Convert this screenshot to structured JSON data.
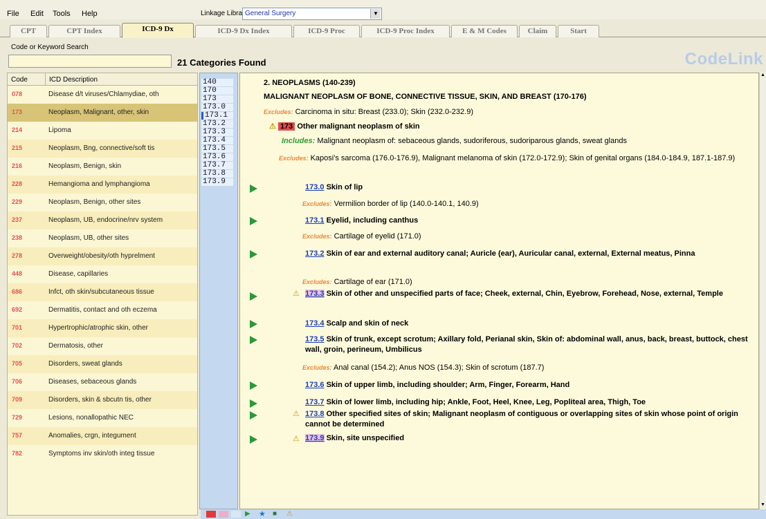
{
  "menu": {
    "file": "File",
    "edit": "Edit",
    "tools": "Tools",
    "help": "Help"
  },
  "linkage": {
    "label": "Linkage Library:",
    "value": "General Surgery"
  },
  "tabs": [
    "CPT",
    "CPT Index",
    "ICD-9 Dx",
    "ICD-9 Dx Index",
    "ICD-9 Proc",
    "ICD-9 Proc Index",
    "E & M Codes",
    "Claim",
    "Start"
  ],
  "search": {
    "label": "Code or Keyword Search",
    "value": ""
  },
  "categories_found": "21 Categories Found",
  "logo": "CodeLink",
  "table": {
    "col_code": "Code",
    "col_desc": "ICD Description",
    "rows": [
      {
        "code": "078",
        "desc": "Disease d/t viruses/Chlamydiae, oth"
      },
      {
        "code": "173",
        "desc": "Neoplasm, Malignant, other, skin"
      },
      {
        "code": "214",
        "desc": "Lipoma"
      },
      {
        "code": "215",
        "desc": "Neoplasm, Bng, connective/soft tis"
      },
      {
        "code": "216",
        "desc": "Neoplasm, Benign, skin"
      },
      {
        "code": "228",
        "desc": "Hemangioma and lymphangioma"
      },
      {
        "code": "229",
        "desc": "Neoplasm, Benign, other sites"
      },
      {
        "code": "237",
        "desc": "Neoplasm, UB, endocrine/nrv system"
      },
      {
        "code": "238",
        "desc": "Neoplasm, UB, other sites"
      },
      {
        "code": "278",
        "desc": "Overweight/obesity/oth hyprelment"
      },
      {
        "code": "448",
        "desc": "Disease, capillaries"
      },
      {
        "code": "686",
        "desc": "Infct, oth skin/subcutaneous tissue"
      },
      {
        "code": "692",
        "desc": "Dermatitis, contact and oth eczema"
      },
      {
        "code": "701",
        "desc": "Hypertrophic/atrophic skin, other"
      },
      {
        "code": "702",
        "desc": "Dermatosis, other"
      },
      {
        "code": "705",
        "desc": "Disorders, sweat glands"
      },
      {
        "code": "706",
        "desc": "Diseases, sebaceous glands"
      },
      {
        "code": "709",
        "desc": "Disorders, skin & sbcutn tis, other"
      },
      {
        "code": "729",
        "desc": "Lesions, nonallopathic NEC"
      },
      {
        "code": "757",
        "desc": "Anomalies, crgn, integument"
      },
      {
        "code": "782",
        "desc": "Symptoms inv skin/oth integ tissue"
      }
    ]
  },
  "subcodes": [
    "140",
    "170",
    "173",
    "173.0",
    "173.1",
    "173.2",
    "173.3",
    "173.4",
    "173.5",
    "173.6",
    "173.7",
    "173.8",
    "173.9"
  ],
  "content": {
    "chapter": "2. NEOPLASMS (140-239)",
    "section": "MALIGNANT NEOPLASM OF BONE, CONNECTIVE TISSUE, SKIN, AND BREAST (170-176)",
    "excludes_word": "Excludes:",
    "includes_word": "Includes:",
    "section_excl": "Carcinoma in situ: Breast (233.0); Skin (232.0-232.9)",
    "cat_code": "173",
    "cat_title": "Other malignant neoplasm of skin",
    "cat_incl": "Malignant neoplasm of: sebaceous glands, sudoriferous, sudoriparous glands, sweat glands",
    "cat_excl": "Kaposi's sarcoma (176.0-176.9), Malignant melanoma of skin (172.0-172.9); Skin of genital organs (184.0-184.9, 187.1-187.9)",
    "e0_code": "173.0",
    "e0_text": "Skin of lip",
    "e0_excl": "Vermilion border of lip (140.0-140.1, 140.9)",
    "e1_code": "173.1",
    "e1_text": "Eyelid, including canthus",
    "e1_excl": "Cartilage of eyelid (171.0)",
    "e2_code": "173.2",
    "e2_text": "Skin of ear and external auditory canal; Auricle (ear), Auricular canal, external, External meatus, Pinna",
    "e2_excl": "Cartilage of ear (171.0)",
    "e3_code": "173.3",
    "e3_text": "Skin of other and unspecified parts of face; Cheek, external, Chin, Eyebrow, Forehead, Nose, external, Temple",
    "e4_code": "173.4",
    "e4_text": "Scalp and skin of neck",
    "e5_code": "173.5",
    "e5_text": "Skin of trunk, except scrotum; Axillary fold, Perianal skin, Skin of: abdominal wall, anus, back, breast, buttock, chest wall, groin, perineum, Umbilicus",
    "e5_excl": "Anal canal (154.2); Anus NOS (154.3); Skin of scrotum (187.7)",
    "e6_code": "173.6",
    "e6_text": "Skin of upper limb, including shoulder; Arm, Finger, Forearm, Hand",
    "e7_code": "173.7",
    "e7_text": "Skin of lower limb, including hip; Ankle, Foot, Heel, Knee, Leg, Popliteal area, Thigh, Toe",
    "e8_code": "173.8",
    "e8_text": "Other specified sites of skin; Malignant neoplasm of contiguous or overlapping sites of skin whose point of origin cannot be determined",
    "e9_code": "173.9",
    "e9_text": "Skin, site unspecified"
  },
  "colors": {
    "accent_red": "#e34b4b",
    "link_blue": "#1a40b8",
    "arrow_green": "#2a9a36",
    "excludes_orange": "#e8873a",
    "includes_green": "#2e9a2e"
  }
}
